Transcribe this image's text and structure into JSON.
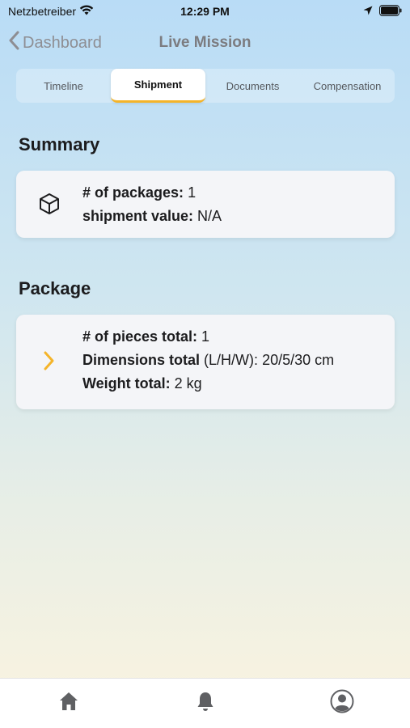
{
  "status_bar": {
    "carrier": "Netzbetreiber",
    "time": "12:29 PM"
  },
  "nav": {
    "back_label": "Dashboard",
    "title": "Live Mission"
  },
  "tabs": [
    {
      "label": "Timeline",
      "active": false
    },
    {
      "label": "Shipment",
      "active": true
    },
    {
      "label": "Documents",
      "active": false
    },
    {
      "label": "Compensation",
      "active": false
    }
  ],
  "summary": {
    "title": "Summary",
    "icon": "package-box-icon",
    "rows": [
      {
        "label": "# of packages:",
        "value": "1"
      },
      {
        "label": "shipment value:",
        "value": "N/A"
      }
    ]
  },
  "package": {
    "title": "Package",
    "icon": "chevron-right-icon",
    "rows": [
      {
        "label": "# of pieces total:",
        "extra": "",
        "value": "1"
      },
      {
        "label": "Dimensions total",
        "extra": "(L/H/W):",
        "value": "20/5/30 cm"
      },
      {
        "label": "Weight total:",
        "extra": "",
        "value": "2 kg"
      }
    ]
  },
  "tab_bar": {
    "items": [
      "home-icon",
      "bell-icon",
      "profile-icon"
    ]
  },
  "colors": {
    "accent": "#f4b42a",
    "nav_gray": "#7c7c80",
    "card_bg": "#f4f5f8"
  }
}
